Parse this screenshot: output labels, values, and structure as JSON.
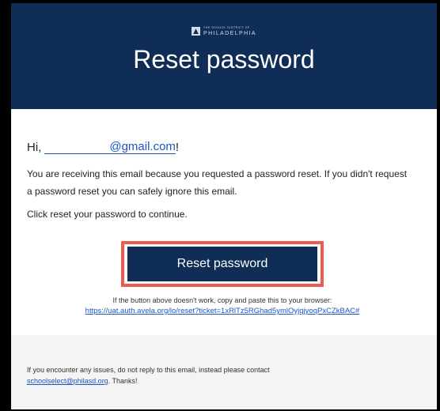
{
  "header": {
    "logo_line1": "THE SCHOOL DISTRICT OF",
    "logo_line2": "PHILADELPHIA",
    "title": "Reset password"
  },
  "body": {
    "greeting_prefix": "Hi,",
    "email_address": "@gmail.com",
    "greeting_suffix": "!",
    "paragraph1": "You are receiving this email because you requested a password reset. If you didn't request a password reset you can safely ignore this email.",
    "paragraph2": "Click reset your password to continue.",
    "button_label": "Reset password",
    "fallback_text": "If the button above doesn't work, copy and paste this to your browser:",
    "fallback_url": "https://uat.auth.avela.org/lo/reset?ticket=1xRlTz5RGhad5ymlOyjqjyoqPxCZkBAC#"
  },
  "footer": {
    "text_prefix": "If you encounter any issues, do not reply to this email, instead please contact",
    "contact_email": "schoolselect@philasd.org",
    "text_suffix": ". Thanks!"
  },
  "colors": {
    "header_bg": "#0f2d57",
    "button_bg": "#0f2d57",
    "highlight_outline": "#ec5b4e",
    "link": "#1a56c4",
    "footer_bg": "#f4f4f4"
  }
}
